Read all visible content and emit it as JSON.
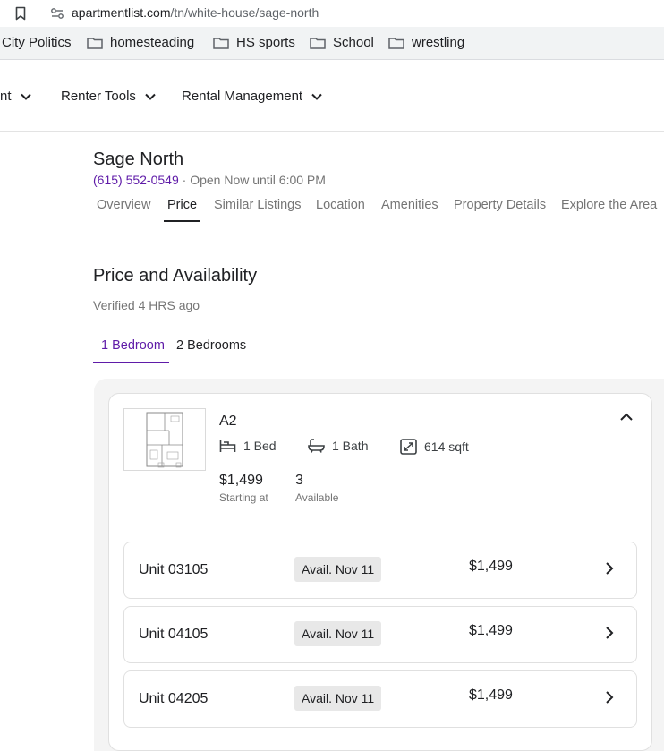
{
  "browser": {
    "url_host": "apartmentlist.com",
    "url_path": "/tn/white-house/sage-north"
  },
  "bookmarks": [
    "City Politics",
    "homesteading",
    "HS sports",
    "School",
    "wrestling"
  ],
  "site_nav": [
    "nt",
    "Renter Tools",
    "Rental Management"
  ],
  "property": {
    "name": "Sage North",
    "phone": "(615) 552-0549",
    "hours": " · Open Now until 6:00 PM"
  },
  "tabs": [
    "Overview",
    "Price",
    "Similar Listings",
    "Location",
    "Amenities",
    "Property Details",
    "Explore the Area"
  ],
  "active_tab": "Price",
  "section": {
    "title": "Price and Availability",
    "verified": "Verified 4 HRS ago"
  },
  "bedroom_tabs": [
    "1 Bedroom",
    "2 Bedrooms"
  ],
  "floorplan": {
    "name": "A2",
    "beds": "1 Bed",
    "baths": "1 Bath",
    "sqft": "614 sqft",
    "price": "$1,499",
    "price_label": "Starting at",
    "available": "3",
    "available_label": "Available"
  },
  "units": [
    {
      "name": "Unit 03105",
      "avail": "Avail. Nov 11",
      "price": "$1,499"
    },
    {
      "name": "Unit 04105",
      "avail": "Avail. Nov 11",
      "price": "$1,499"
    },
    {
      "name": "Unit 04205",
      "avail": "Avail. Nov 11",
      "price": "$1,499"
    }
  ],
  "colors": {
    "accent": "#5f1ba8",
    "text": "#202124",
    "muted": "#757575"
  },
  "icons": [
    "bookmark-icon",
    "site-info-icon",
    "folder-icon",
    "chevron-down-icon",
    "bed-icon",
    "bath-icon",
    "area-icon",
    "chevron-up-icon",
    "chevron-right-icon"
  ]
}
